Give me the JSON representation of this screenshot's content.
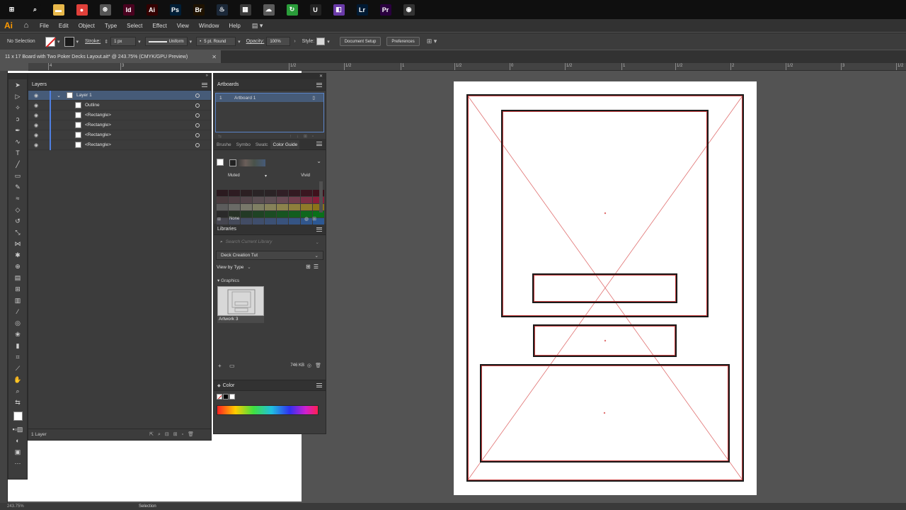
{
  "taskbar": {
    "icons": [
      {
        "name": "windows-start-icon",
        "glyph": "⊞",
        "color": "#0f0f0f"
      },
      {
        "name": "search-icon",
        "glyph": "⌕",
        "color": "#0f0f0f"
      },
      {
        "name": "file-explorer-icon",
        "glyph": "▬",
        "color": "#e8b84a"
      },
      {
        "name": "chrome-icon",
        "glyph": "●",
        "color": "#e0403a"
      },
      {
        "name": "blender-icon",
        "glyph": "⊛",
        "color": "#555555"
      },
      {
        "name": "indesign-icon",
        "glyph": "Id",
        "color": "#49021f"
      },
      {
        "name": "illustrator-icon",
        "glyph": "Ai",
        "color": "#330000"
      },
      {
        "name": "photoshop-icon",
        "glyph": "Ps",
        "color": "#001e36"
      },
      {
        "name": "bridge-icon",
        "glyph": "Br",
        "color": "#1e1200"
      },
      {
        "name": "steam-icon",
        "glyph": "♨",
        "color": "#1b2838"
      },
      {
        "name": "calculator-icon",
        "glyph": "▦",
        "color": "#3a3a3a"
      },
      {
        "name": "cloud-app-icon",
        "glyph": "☁",
        "color": "#5a5a5a"
      },
      {
        "name": "green-app-icon",
        "glyph": "↻",
        "color": "#2a9d3a"
      },
      {
        "name": "unreal-engine-icon",
        "glyph": "U",
        "color": "#222222"
      },
      {
        "name": "visual-studio-icon",
        "glyph": "◧",
        "color": "#6a3aa8"
      },
      {
        "name": "lightroom-icon",
        "glyph": "Lr",
        "color": "#001a33"
      },
      {
        "name": "premiere-icon",
        "glyph": "Pr",
        "color": "#2a003f"
      },
      {
        "name": "obs-icon",
        "glyph": "◉",
        "color": "#333333"
      }
    ]
  },
  "menubar": {
    "logo": "Ai",
    "items": [
      "File",
      "Edit",
      "Object",
      "Type",
      "Select",
      "Effect",
      "View",
      "Window",
      "Help"
    ]
  },
  "controlbar": {
    "selection": "No Selection",
    "stroke_label": "Stroke:",
    "stroke_weight": "1 px",
    "stroke_profile": "Uniform",
    "brush": "5 pt. Round",
    "opacity_label": "Opacity:",
    "opacity_value": "100%",
    "style_label": "Style:",
    "document_setup": "Document Setup",
    "preferences": "Preferences"
  },
  "document": {
    "tab_title": "11 x 17 Board with Two Poker Decks Layout.ait* @ 243.75% (CMYK/GPU Preview)"
  },
  "ruler_h_labels": [
    "4",
    "3",
    "1/2",
    "1/2",
    "1",
    "1/2",
    "0",
    "1/2",
    "1",
    "1/2",
    "2",
    "1/2",
    "3",
    "1/2",
    "4"
  ],
  "layers_panel": {
    "title": "Layers",
    "rows": [
      {
        "name": "Layer 1",
        "selected": true,
        "top": true
      },
      {
        "name": "Outline"
      },
      {
        "name": "<Rectangle>"
      },
      {
        "name": "<Rectangle>"
      },
      {
        "name": "<Rectangle>"
      },
      {
        "name": "<Rectangle>"
      }
    ],
    "footer": "1 Layer"
  },
  "artboards_panel": {
    "title": "Artboards",
    "row_number": "1",
    "row_name": "Artboard 1"
  },
  "guide_panel": {
    "tabs": [
      "Brushe",
      "Symbo",
      "Swatc",
      "Color Guide"
    ],
    "muted": "Muted",
    "vivid": "Vivid",
    "none": "None",
    "swatches": [
      "#2b1a1f",
      "#2e1c22",
      "#2c1f22",
      "#2a2426",
      "#2b2326",
      "#311f26",
      "#331a22",
      "#3a1620",
      "#3f111c",
      "#4a3b3e",
      "#503f44",
      "#54454a",
      "#5a4e52",
      "#5e4f54",
      "#684a54",
      "#713e4d",
      "#7d2f45",
      "#8a1e3a",
      "#5c5c5c",
      "#6a6a66",
      "#78786a",
      "#7f7f63",
      "#868259",
      "#8c834c",
      "#8e7f3c",
      "#8f7a2a",
      "#8c7318",
      "#2a2a2a",
      "#263126",
      "#233a25",
      "#1f4324",
      "#1b4c23",
      "#175521",
      "#135e1f",
      "#0f671d",
      "#0a701a",
      "#464650",
      "#454a5a",
      "#424c64",
      "#3f4e6c",
      "#3c5074",
      "#39527c",
      "#355484",
      "#31568c",
      "#2c5894"
    ]
  },
  "libraries_panel": {
    "title": "Libraries",
    "search_placeholder": "Search Current Library",
    "library_name": "Deck Creation Tut",
    "view_by": "View by Type",
    "section": "Graphics",
    "item_name": "Artwork 3",
    "size": "746 KB"
  },
  "color_panel": {
    "title": "Color"
  },
  "statusbar": {
    "zoom": "243.75%",
    "tool": "Selection"
  },
  "colors": {
    "accent": "#4f7fe0",
    "selection_row": "#465b78",
    "guide_red": "#e07070",
    "illustrator_orange": "#ff9a00"
  }
}
